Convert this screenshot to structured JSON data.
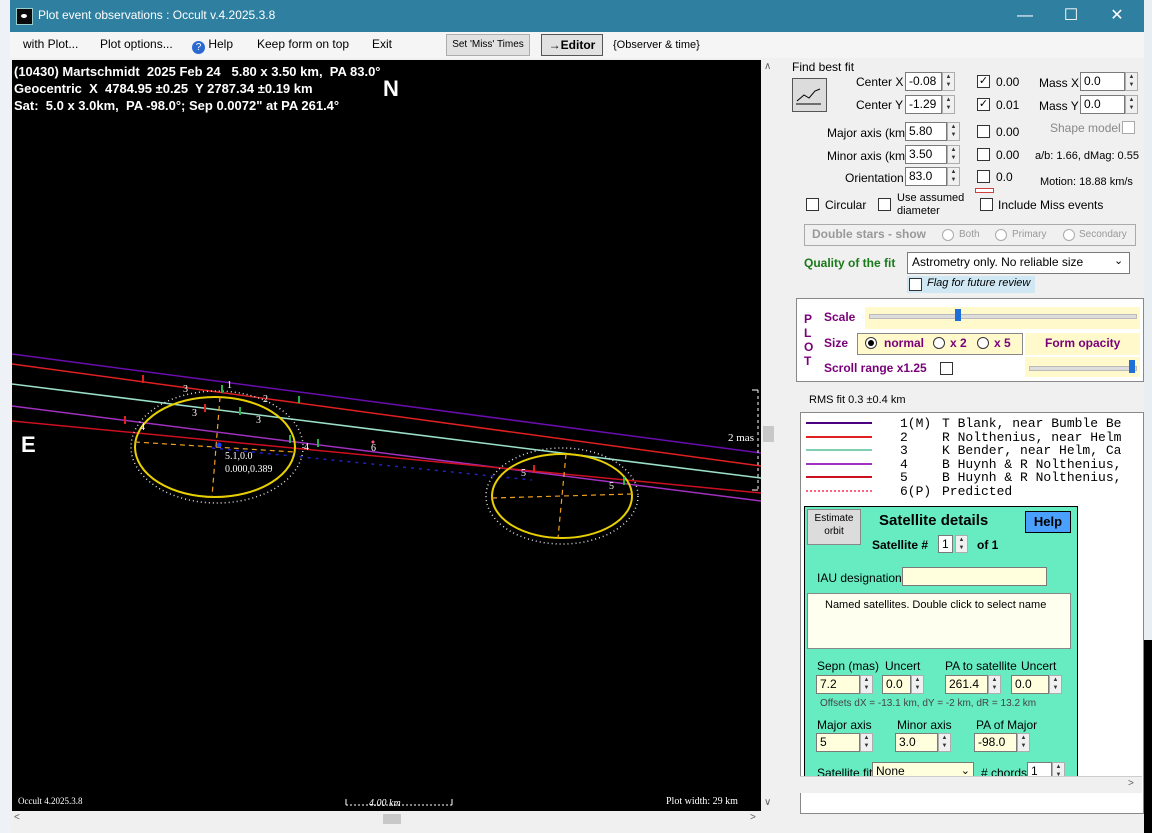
{
  "window": {
    "title": "Plot event observations : Occult v.4.2025.3.8"
  },
  "menu": {
    "with_plot": "with Plot...",
    "plot_options": "Plot options...",
    "help": "Help",
    "keep_form": "Keep form on top",
    "exit": "Exit",
    "set_miss": "Set 'Miss' Times",
    "editor": "→Editor",
    "observer_time": "{Observer & time}"
  },
  "plot": {
    "line1": "(10430) Martschmidt  2025 Feb 24   5.80 x 3.50 km,  PA 83.0°",
    "line2": "Geocentric  X  4784.95 ±0.25  Y 2787.34 ±0.19 km",
    "line3": "Sat:  5.0 x 3.0km,  PA -98.0°; Sep 0.0072\" at PA 261.4°",
    "north": "N",
    "east": "E",
    "center_label1": "5.1,0.0",
    "center_label2": "0.000,0.389",
    "mas_label": "2 mas",
    "version": "Occult 4.2025.3.8",
    "scale_bar": "4.00 km",
    "plot_width": "Plot width: 29 km",
    "chord_numbers": [
      "1",
      "2",
      "3",
      "3",
      "4",
      "4",
      "5",
      "5",
      "6"
    ],
    "colors": {
      "chord1": "#6a0dad",
      "chord2": "#e02020",
      "chord3": "#9be0c8",
      "chord4": "#a030c0",
      "chord5": "#cc1020",
      "ellipse": "#e8d000",
      "axes": "#f0a020"
    }
  },
  "fit": {
    "find_best_fit": "Find best fit",
    "center_x_label": "Center X",
    "center_x": "-0.08",
    "center_x_cb": "0.00",
    "center_y_label": "Center Y",
    "center_y": "-1.29",
    "center_y_cb": "0.01",
    "mass_x_label": "Mass X",
    "mass_x": "0.0",
    "mass_y_label": "Mass Y",
    "mass_y": "0.0",
    "major_label": "Major axis (km)",
    "major": "5.80",
    "major_cb": "0.00",
    "minor_label": "Minor axis (km)",
    "minor": "3.50",
    "minor_cb": "0.00",
    "orient_label": "Orientation",
    "orient": "83.0",
    "orient_cb": "0.0",
    "shape_model": "Shape model",
    "ab_dmag": "a/b: 1.66, dMag: 0.55",
    "motion": "Motion: 18.88 km/s",
    "circular": "Circular",
    "use_assumed_1": "Use assumed",
    "use_assumed_2": "diameter",
    "include_miss": "Include Miss events",
    "double_stars": "Double stars - show",
    "both": "Both",
    "primary": "Primary",
    "secondary": "Secondary",
    "quality_label": "Quality of the fit",
    "quality_value": "Astrometry only. No reliable size",
    "flag_review": "Flag for future review"
  },
  "plotopts": {
    "plot_vertical": [
      "P",
      "L",
      "O",
      "T"
    ],
    "scale": "Scale",
    "size": "Size",
    "normal": "normal",
    "x2": "x 2",
    "x5": "x 5",
    "form_opacity": "Form opacity",
    "scroll_range": "Scroll range x1.25",
    "scale_level": 0.33,
    "opacity_level": 1.0
  },
  "rms": "RMS fit 0.3 ±0.4 km",
  "legend": [
    {
      "id": "1(M)",
      "name": "T Blank, near Bumble Be",
      "color": "#4b0082"
    },
    {
      "id": "2   ",
      "name": "R Nolthenius, near Helm",
      "color": "#e02020"
    },
    {
      "id": "3   ",
      "name": "K Bender, near Helm, Ca",
      "color": "#7fd0b0"
    },
    {
      "id": "4   ",
      "name": "B Huynh & R Nolthenius,",
      "color": "#a030c0"
    },
    {
      "id": "5   ",
      "name": "B Huynh & R Nolthenius,",
      "color": "#cc1020"
    },
    {
      "id": "6(P)",
      "name": "Predicted",
      "color": "#ff6080"
    }
  ],
  "satellite": {
    "estimate_orbit_1": "Estimate",
    "estimate_orbit_2": "orbit",
    "title": "Satellite details",
    "help": "Help",
    "sat_num_label": "Satellite #",
    "sat_num": "1",
    "of_label": "of 1",
    "iau_label": "IAU designation",
    "iau_value": "",
    "named_note": "Named satellites.  Double click to select name",
    "sepn_label": "Sepn (mas)",
    "sepn": "7.2",
    "uncert_label": "Uncert",
    "sepn_unc": "0.0",
    "pa_label": "PA to satellite",
    "pa": "261.4",
    "pa_unc": "0.0",
    "offsets": "Offsets  dX = -13.1 km, dY = -2 km, dR = 13.2 km",
    "major_label": "Major axis",
    "major": "5",
    "minor_label": "Minor axis",
    "minor": "3.0",
    "pa_major_label": "PA of Major",
    "pa_major": "-98.0",
    "fit_label": "Satellite fit",
    "fit_value": "None",
    "chords_label": "# chords",
    "chords": "1"
  }
}
